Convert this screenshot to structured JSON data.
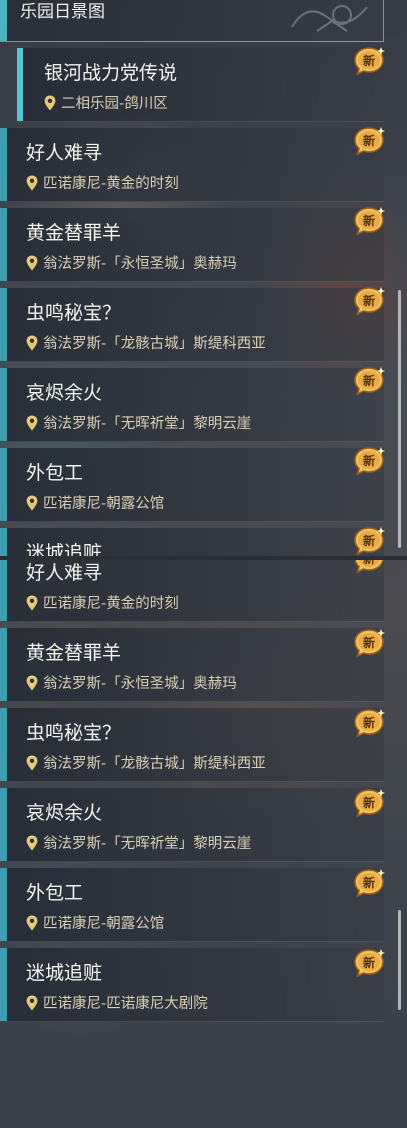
{
  "header": {
    "title": "乐园日景图"
  },
  "selected_item": {
    "name": "银河战力党传说",
    "location": "二相乐园-鸽川区",
    "badge": "新"
  },
  "quests": [
    {
      "name": "好人难寻",
      "location": "匹诺康尼-黄金的时刻",
      "badge": "新"
    },
    {
      "name": "黄金替罪羊",
      "location": "翁法罗斯-「永恒圣城」奥赫玛",
      "badge": "新"
    },
    {
      "name": "虫鸣秘宝？",
      "location": "翁法罗斯-「龙骸古城」斯缇科西亚",
      "badge": "新"
    },
    {
      "name": "哀烬余火",
      "location": "翁法罗斯-「无晖祈堂」黎明云崖",
      "badge": "新"
    },
    {
      "name": "外包工",
      "location": "匹诺康尼-朝露公馆",
      "badge": "新"
    },
    {
      "name": "迷城追赃",
      "location": "匹诺康尼-匹诺康尼大剧院",
      "badge": "新"
    }
  ],
  "colors": {
    "accent": "#3e9eaf",
    "selected_accent": "#56c3d5",
    "badge_gold": "#e8a640",
    "location_text": "#d9cfb7"
  },
  "icons": {
    "location": "map-pin-icon",
    "new_badge": "new-badge-icon",
    "header_decoration": "ornament-pattern-icon"
  }
}
